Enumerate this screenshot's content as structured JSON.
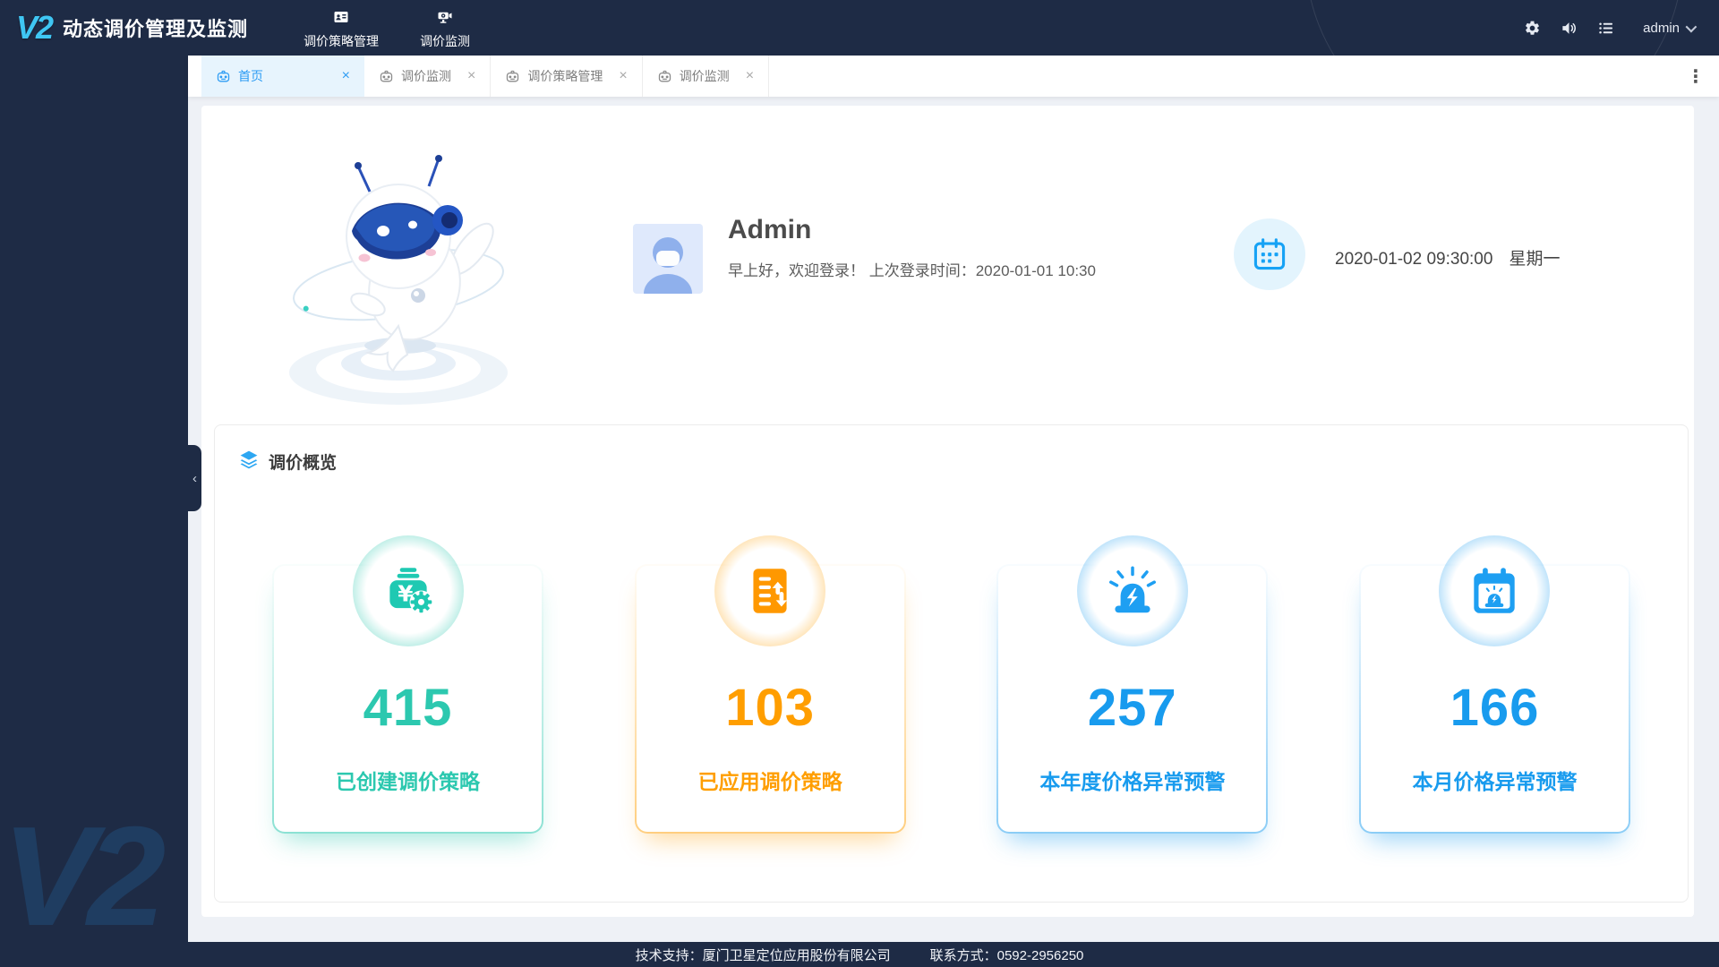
{
  "header": {
    "logo": "V2",
    "title": "动态调价管理及监测",
    "nav": [
      {
        "label": "调价策略管理",
        "icon": "id-card-icon"
      },
      {
        "label": "调价监测",
        "icon": "camera-icon"
      }
    ],
    "action_icons": [
      "gear-icon",
      "speaker-icon",
      "list-icon"
    ],
    "user": {
      "name": "admin",
      "icon": "chevron-down-icon"
    }
  },
  "tabs": {
    "items": [
      {
        "label": "首页",
        "icon": "taxi-icon",
        "active": true
      },
      {
        "label": "调价监测",
        "icon": "taxi-icon",
        "active": false
      },
      {
        "label": "调价策略管理",
        "icon": "taxi-icon",
        "active": false
      },
      {
        "label": "调价监测",
        "icon": "taxi-icon",
        "active": false
      }
    ],
    "close_glyph": "×",
    "overflow_menu_glyph": "⋮"
  },
  "sidebar": {
    "watermark": "V2",
    "collapse_glyph": "‹"
  },
  "profile": {
    "name": "Admin",
    "greeting": "早上好，欢迎登录！ 上次登录时间：2020-01-01 10:30",
    "datetime": "2020-01-02 09:30:00",
    "weekday": "星期一",
    "avatar_icon": "user-avatar",
    "calendar_icon": "calendar-icon",
    "mascot": "robot-dolphin-mascot"
  },
  "overview": {
    "title": "调价概览",
    "title_icon": "layers-icon",
    "stats": [
      {
        "value": "415",
        "label": "已创建调价策略",
        "icon": "money-gear-icon",
        "color": "#2cc8af"
      },
      {
        "value": "103",
        "label": "已应用调价策略",
        "icon": "doc-arrows-icon",
        "color": "#ff9e00"
      },
      {
        "value": "257",
        "label": "本年度价格异常预警",
        "icon": "siren-icon",
        "color": "#189bee"
      },
      {
        "value": "166",
        "label": "本月价格异常预警",
        "icon": "calendar-alert-icon",
        "color": "#189bee"
      }
    ]
  },
  "footer": {
    "support": "技术支持：厦门卫星定位应用股份有限公司",
    "contact": "联系方式：0592-2956250"
  }
}
